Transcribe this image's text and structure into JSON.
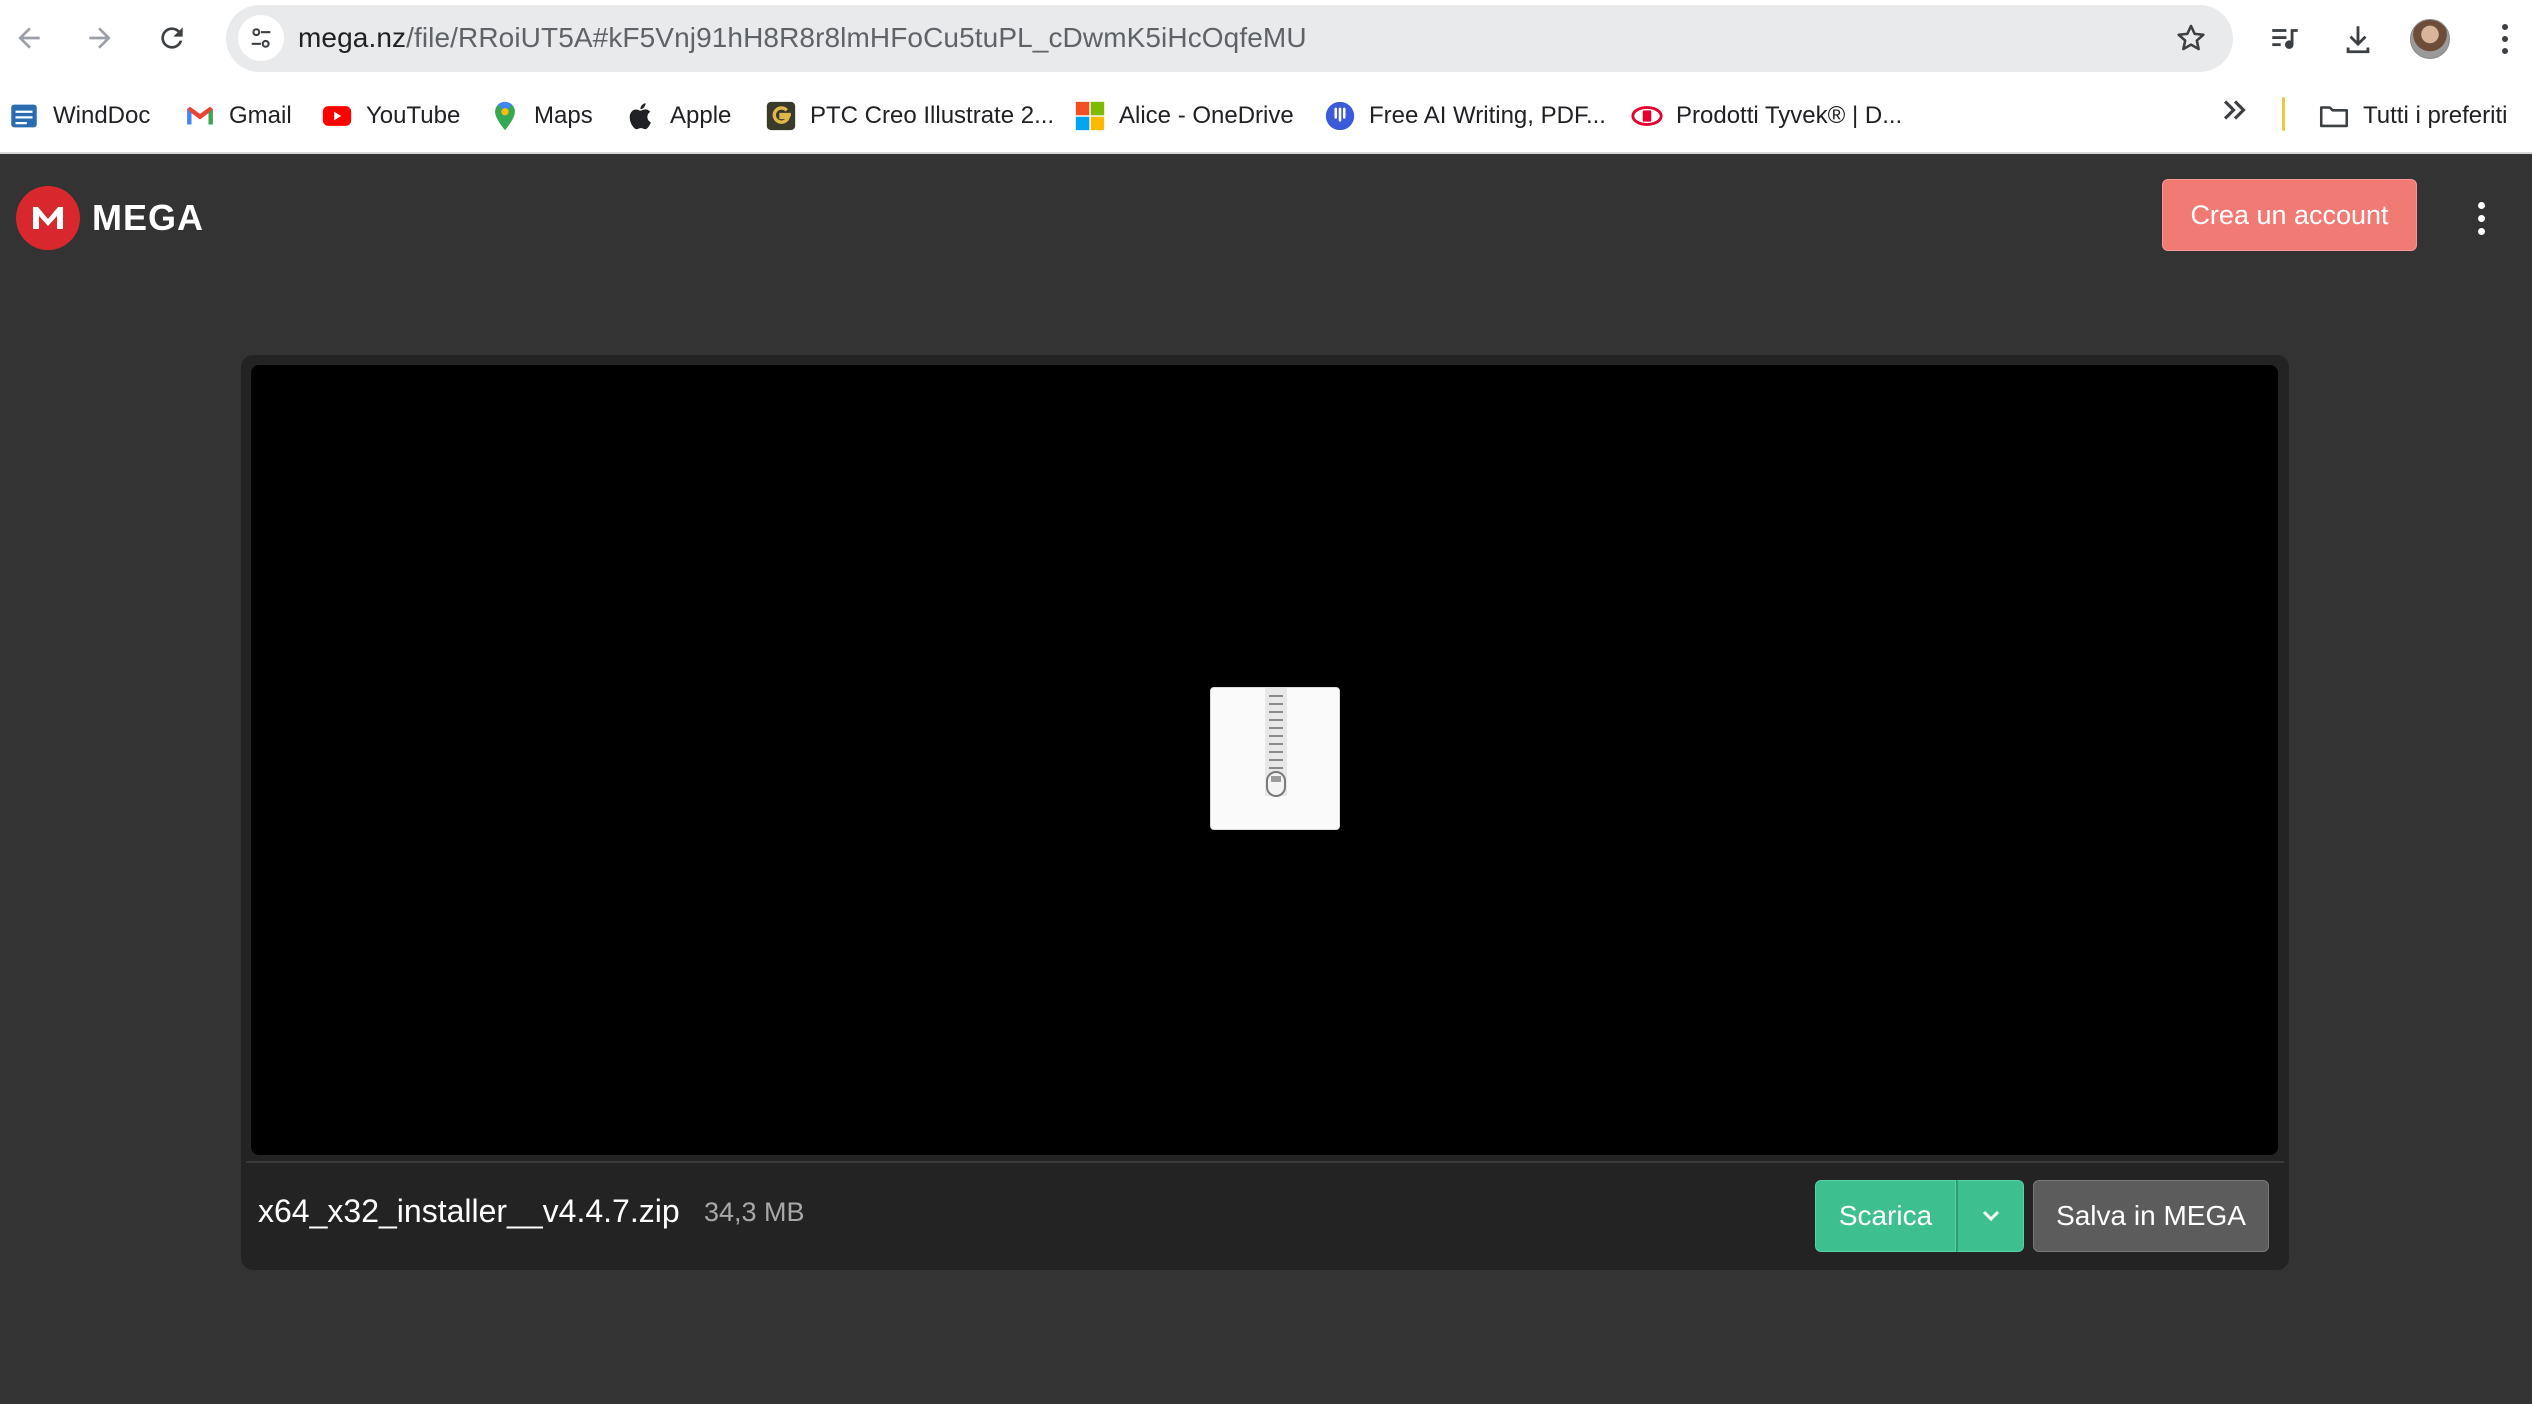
{
  "browser": {
    "url_host": "mega.nz",
    "url_path": "/file/RRoiUT5A#kF5Vnj91hH8R8r8lmHFoCu5tuPL_cDwmK5iHcOqfeMU",
    "icons": {
      "back": "back-arrow-icon",
      "forward": "forward-arrow-icon",
      "reload": "reload-icon",
      "site_info": "tune-icon",
      "bookmark_star": "star-icon",
      "media": "media-playlist-icon",
      "downloads": "download-icon",
      "profile": "avatar",
      "menu": "more-vert-icon"
    }
  },
  "bookmarks": {
    "items": [
      {
        "label": "WindDoc",
        "icon": "winddoc-icon"
      },
      {
        "label": "Gmail",
        "icon": "gmail-icon"
      },
      {
        "label": "YouTube",
        "icon": "youtube-icon"
      },
      {
        "label": "Maps",
        "icon": "maps-icon"
      },
      {
        "label": "Apple",
        "icon": "apple-icon"
      },
      {
        "label": "PTC Creo Illustrate 2...",
        "icon": "ptc-icon"
      },
      {
        "label": "Alice - OneDrive",
        "icon": "microsoft-icon"
      },
      {
        "label": "Free AI Writing, PDF...",
        "icon": "ai-writing-icon"
      },
      {
        "label": "Prodotti Tyvek® | D...",
        "icon": "dupont-icon"
      }
    ],
    "overflow_icon": "chevron-double-right-icon",
    "all_bookmarks_label": "Tutti i preferiti"
  },
  "mega": {
    "logo_text": "MEGA",
    "create_account_label": "Crea un account",
    "file": {
      "name": "x64_x32_installer__v4.4.7.zip",
      "size": "34,3 MB",
      "type_icon": "zip-file-icon"
    },
    "download_label": "Scarica",
    "save_label": "Salva in MEGA"
  },
  "colors": {
    "page_bg": "#333333",
    "card_bg": "#232323",
    "mega_red": "#d9272e",
    "create_btn": "#f27a75",
    "download_green": "#3ebf8f",
    "save_btn": "#5c5c5c"
  }
}
